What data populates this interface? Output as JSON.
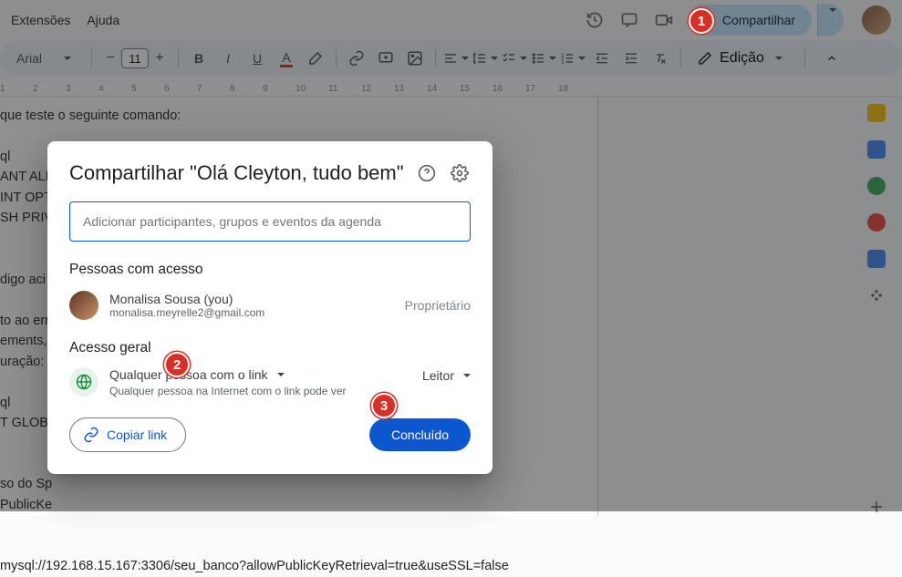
{
  "menu": {
    "extensoes": "Extensões",
    "ajuda": "Ajuda"
  },
  "header": {
    "share_label": "Compartilhar"
  },
  "toolbar": {
    "font": "Arial",
    "fontsize": "11",
    "edit_mode": "Edição"
  },
  "ruler_marks": [
    "1",
    "2",
    "3",
    "4",
    "5",
    "6",
    "7",
    "8",
    "9",
    "10",
    "11",
    "12",
    "13",
    "14",
    "15",
    "16",
    "17",
    "18"
  ],
  "doc_lines": [
    "que teste o seguinte comando:",
    "",
    "ql",
    "ANT ALL",
    "INT OPTIO",
    "SH PRIV",
    "",
    "",
    "digo aci",
    "",
    "to ao erro",
    "ements,",
    "uração:",
    "",
    "ql",
    "T GLOBAL",
    "",
    "",
    "so do Sp",
    "PublicKe",
    "",
    "",
    "mysql://192.168.15.167:3306/seu_banco?allowPublicKeyRetrieval=true&useSSL=false"
  ],
  "dialog": {
    "title": "Compartilhar \"Olá Cleyton, tudo bem\"",
    "add_placeholder": "Adicionar participantes, grupos e eventos da agenda",
    "people_section": "Pessoas com acesso",
    "owner": {
      "name": "Monalisa Sousa (you)",
      "email": "monalisa.meyrelle2@gmail.com",
      "role": "Proprietário"
    },
    "general_section": "Acesso geral",
    "anyone_label": "Qualquer pessoa com o link",
    "anyone_desc": "Qualquer pessoa na Internet com o link pode ver",
    "role_dd": "Leitor",
    "copy_link": "Copiar link",
    "done": "Concluído"
  },
  "markers": {
    "m1": "1",
    "m2": "2",
    "m3": "3"
  }
}
